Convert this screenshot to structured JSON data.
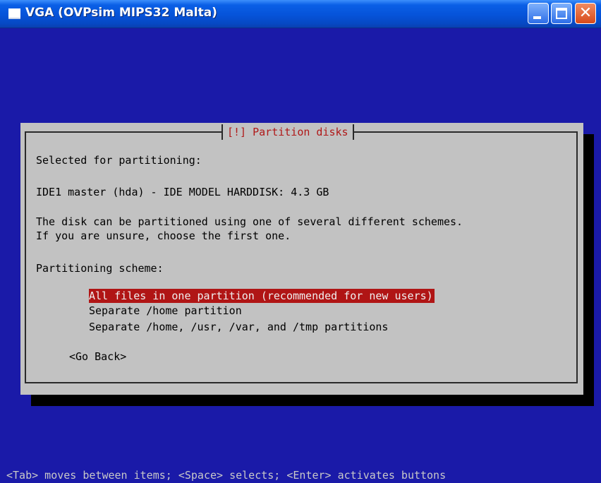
{
  "window": {
    "title": "VGA (OVPsim MIPS32 Malta)",
    "icon": "window-icon",
    "buttons": {
      "minimize": "minimize-icon",
      "maximize": "maximize-icon",
      "close": "✕"
    }
  },
  "dialog": {
    "title": "[!] Partition disks",
    "selected_label": "Selected for partitioning:",
    "disk": "IDE1 master (hda) - IDE MODEL HARDDISK: 4.3 GB",
    "description_line1": "The disk can be partitioned using one of several different schemes.",
    "description_line2": "If you are unsure, choose the first one.",
    "scheme_label": "Partitioning scheme:",
    "options": [
      {
        "label": "All files in one partition (recommended for new users)",
        "selected": true
      },
      {
        "label": "Separate /home partition",
        "selected": false
      },
      {
        "label": "Separate /home, /usr, /var, and /tmp partitions",
        "selected": false
      }
    ],
    "go_back": "<Go Back>"
  },
  "status_bar": "<Tab> moves between items; <Space> selects; <Enter> activates buttons",
  "colors": {
    "background": "#1a1aa8",
    "dialog": "#c2c2c2",
    "highlight": "#b01515",
    "title_text": "#b01818"
  }
}
